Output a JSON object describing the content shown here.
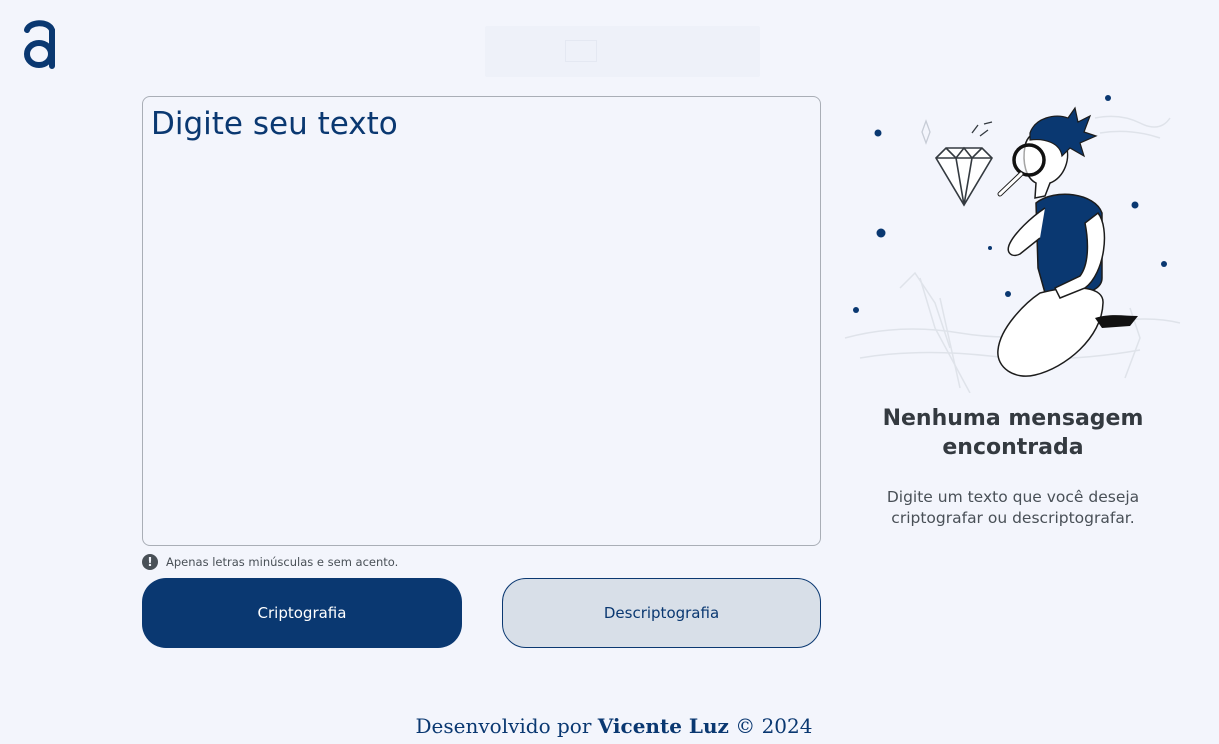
{
  "header": {
    "logo_icon": "alura-a-logo-icon"
  },
  "input": {
    "placeholder": "Digite seu texto",
    "value": ""
  },
  "hint": {
    "icon": "exclamation-circle-icon",
    "text": "Apenas letras minúsculas e sem acento."
  },
  "buttons": {
    "encrypt_label": "Criptografia",
    "decrypt_label": "Descriptografia"
  },
  "output": {
    "illustration": "person-with-magnifying-glass-illustration",
    "empty_title": "Nenhuma mensagem encontrada",
    "empty_description": "Digite um texto que você deseja criptografar ou descriptografar."
  },
  "footer": {
    "prefix": "Desenvolvido por",
    "author": "Vicente Luz",
    "suffix": "© 2024"
  },
  "colors": {
    "background": "#f3f5fc",
    "primary": "#0a3871",
    "secondary_button_bg": "#d8dfe8",
    "title_text": "#343a40",
    "body_text": "#495057"
  }
}
